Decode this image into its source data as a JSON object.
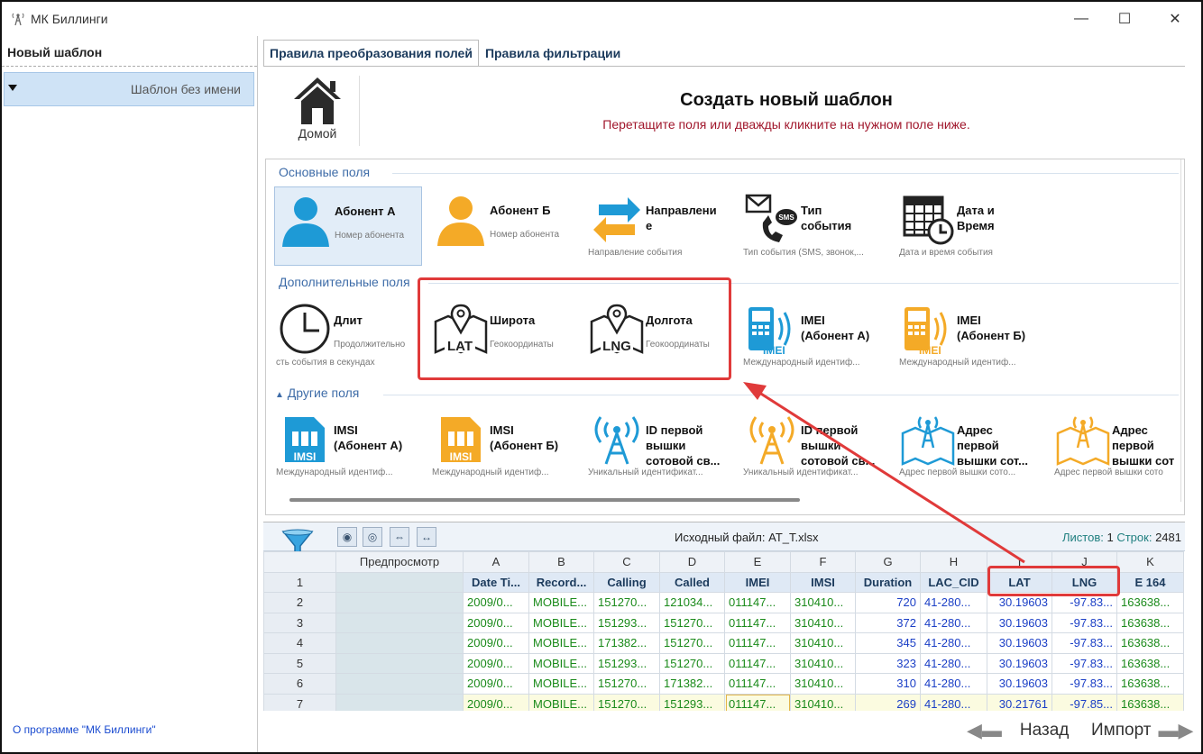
{
  "window": {
    "title": "МК Биллинги"
  },
  "left_panel": {
    "title": "Новый шаблон",
    "item": "Шаблон без имени",
    "about_link": "О программе \"МК Биллинги\""
  },
  "tabs": [
    {
      "label": "Правила преобразования полей"
    },
    {
      "label": "Правила фильтрации"
    }
  ],
  "header": {
    "home_label": "Домой",
    "title": "Создать новый шаблон",
    "subtitle": "Перетащите поля или дважды кликните на нужном поле ниже."
  },
  "groups": {
    "basic": "Основные поля",
    "extra": "Дополнительные поля",
    "other": "Другие поля"
  },
  "fields": {
    "basic": [
      {
        "name": "Абонент А",
        "desc": "Номер абонента",
        "icon": "user-blue-icon"
      },
      {
        "name": "Абонент Б",
        "desc": "Номер абонента",
        "icon": "user-orange-icon"
      },
      {
        "name": "Направлени\nе",
        "desc": "Направление события",
        "icon": "direction-arrows-icon"
      },
      {
        "name": "Тип\nсобытия",
        "desc": "Тип события (SMS, звонок,...",
        "icon": "phone-sms-icon"
      },
      {
        "name": "Дата и\nВремя",
        "desc": "Дата и время события",
        "icon": "calendar-clock-icon"
      }
    ],
    "extra": [
      {
        "name": "Длит",
        "desc": "Продолжительно",
        "desc2": "сть события в секундах",
        "icon": "clock-icon"
      },
      {
        "name": "Широта",
        "desc": "Геокоординаты",
        "icon": "map-lat-icon",
        "badge": "LAT"
      },
      {
        "name": "Долгота",
        "desc": "Геокоординаты",
        "icon": "map-lng-icon",
        "badge": "LNG"
      },
      {
        "name": "IMEI\n(Абонент А)",
        "desc": "Международный идентиф...",
        "icon": "imei-blue-icon",
        "badge": "IMEI"
      },
      {
        "name": "IMEI\n(Абонент Б)",
        "desc": "Международный идентиф...",
        "icon": "imei-orange-icon",
        "badge": "IMEI"
      }
    ],
    "other": [
      {
        "name": "IMSI\n(Абонент А)",
        "desc": "Международный идентиф...",
        "icon": "imsi-blue-icon",
        "badge": "IMSI"
      },
      {
        "name": "IMSI\n(Абонент Б)",
        "desc": "Международный идентиф...",
        "icon": "imsi-orange-icon",
        "badge": "IMSI"
      },
      {
        "name": "ID первой\nвышки\nсотовой св...",
        "desc": "Уникальный идентификат...",
        "icon": "tower-blue-icon"
      },
      {
        "name": "ID первой\nвышки\nсотовой св...",
        "desc": "Уникальный идентификат...",
        "icon": "tower-orange-icon"
      },
      {
        "name": "Адрес\nпервой\nвышки сот...",
        "desc": "Адрес первой вышки сото...",
        "icon": "tower-map-blue-icon"
      },
      {
        "name": "Адрес\nпервой\nвышки сот",
        "desc": "Адрес первой вышки сото",
        "icon": "tower-map-orange-icon"
      }
    ]
  },
  "grid": {
    "source_label": "Исходный файл: AT_T.xlsx",
    "sheets_label": "Листов:",
    "sheets": "1",
    "rows_label": "Строк:",
    "rows_count": "2481",
    "preview_label": "Предпросмотр",
    "columns": [
      "A",
      "B",
      "C",
      "D",
      "E",
      "F",
      "G",
      "H",
      "I",
      "J",
      "K"
    ],
    "header_row": [
      "Date Ti...",
      "Record...",
      "Calling",
      "Called",
      "IMEI",
      "IMSI",
      "Duration",
      "LAC_CID",
      "LAT",
      "LNG",
      "E 164"
    ],
    "row_numbers": [
      "1",
      "2",
      "3",
      "4",
      "5",
      "6",
      "7"
    ],
    "rows": [
      [
        "2009/0...",
        "MOBILE...",
        "151270...",
        "121034...",
        "011147...",
        "310410...",
        "720",
        "41-280...",
        "30.19603",
        "-97.83...",
        "163638..."
      ],
      [
        "2009/0...",
        "MOBILE...",
        "151293...",
        "151270...",
        "011147...",
        "310410...",
        "372",
        "41-280...",
        "30.19603",
        "-97.83...",
        "163638..."
      ],
      [
        "2009/0...",
        "MOBILE...",
        "171382...",
        "151270...",
        "011147...",
        "310410...",
        "345",
        "41-280...",
        "30.19603",
        "-97.83...",
        "163638..."
      ],
      [
        "2009/0...",
        "MOBILE...",
        "151293...",
        "151270...",
        "011147...",
        "310410...",
        "323",
        "41-280...",
        "30.19603",
        "-97.83...",
        "163638..."
      ],
      [
        "2009/0...",
        "MOBILE...",
        "151270...",
        "171382...",
        "011147...",
        "310410...",
        "310",
        "41-280...",
        "30.19603",
        "-97.83...",
        "163638..."
      ],
      [
        "2009/0...",
        "MOBILE...",
        "151270...",
        "151293...",
        "011147...",
        "310410...",
        "269",
        "41-280...",
        "30.21761",
        "-97.85...",
        "163638..."
      ]
    ]
  },
  "nav": {
    "back": "Назад",
    "import": "Импорт"
  },
  "colors": {
    "accent": "#3e6ca8",
    "highlight": "#e03a3a",
    "subtitle": "#a0162b"
  }
}
